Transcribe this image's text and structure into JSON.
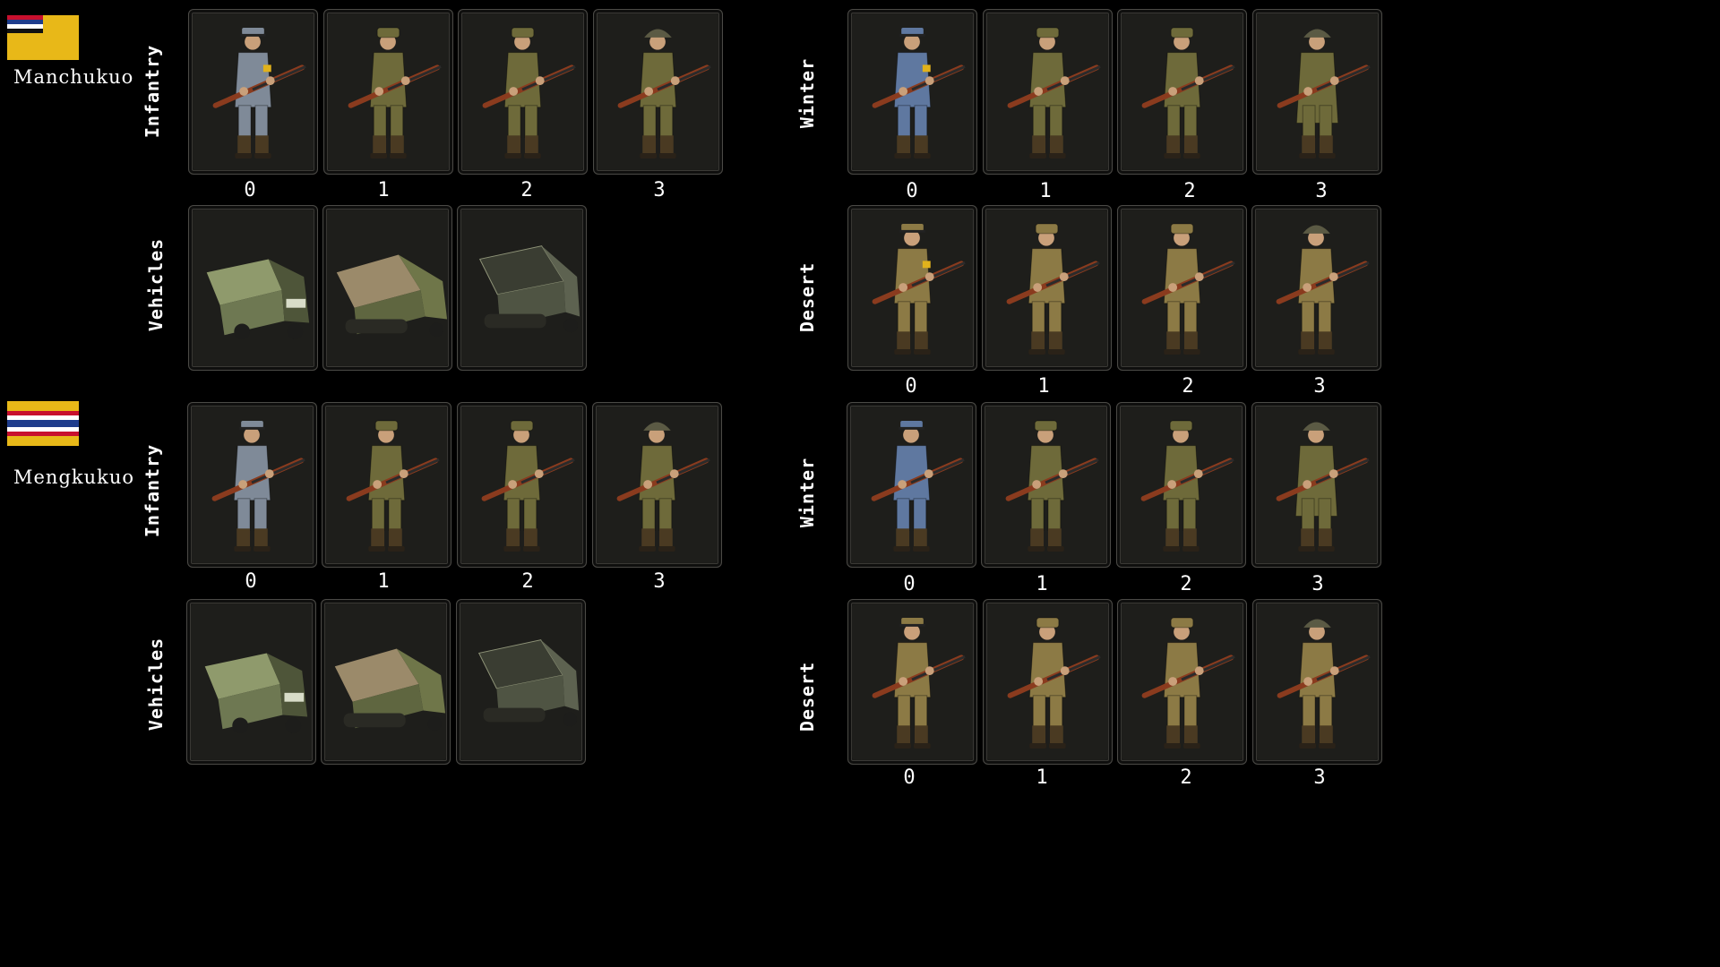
{
  "factions": [
    {
      "name": "Manchukuo",
      "flag_icon": "manchukuo-flag-icon",
      "left_groups": [
        {
          "label": "Infantry",
          "numbers": [
            "0",
            "1",
            "2",
            "3"
          ]
        },
        {
          "label": "Vehicles",
          "numbers": []
        }
      ],
      "right_groups": [
        {
          "label": "Winter",
          "numbers": [
            "0",
            "1",
            "2",
            "3"
          ]
        },
        {
          "label": "Desert",
          "numbers": [
            "0",
            "1",
            "2",
            "3"
          ]
        }
      ]
    },
    {
      "name": "Mengkukuo",
      "flag_icon": "mengkukuo-flag-icon",
      "left_groups": [
        {
          "label": "Infantry",
          "numbers": [
            "0",
            "1",
            "2",
            "3"
          ]
        },
        {
          "label": "Vehicles",
          "numbers": []
        }
      ],
      "right_groups": [
        {
          "label": "Winter",
          "numbers": [
            "0",
            "1",
            "2",
            "3"
          ]
        },
        {
          "label": "Desert",
          "numbers": [
            "0",
            "1",
            "2",
            "3"
          ]
        }
      ]
    }
  ],
  "colors": {
    "background": "#000000",
    "card_bg": "#1a1a18",
    "uniform_olive": "#6e6a3a",
    "uniform_gray": "#7f8a98",
    "uniform_blue": "#5f78a0",
    "uniform_khaki": "#8c7a45",
    "rifle_wood": "#8a3b1e"
  }
}
